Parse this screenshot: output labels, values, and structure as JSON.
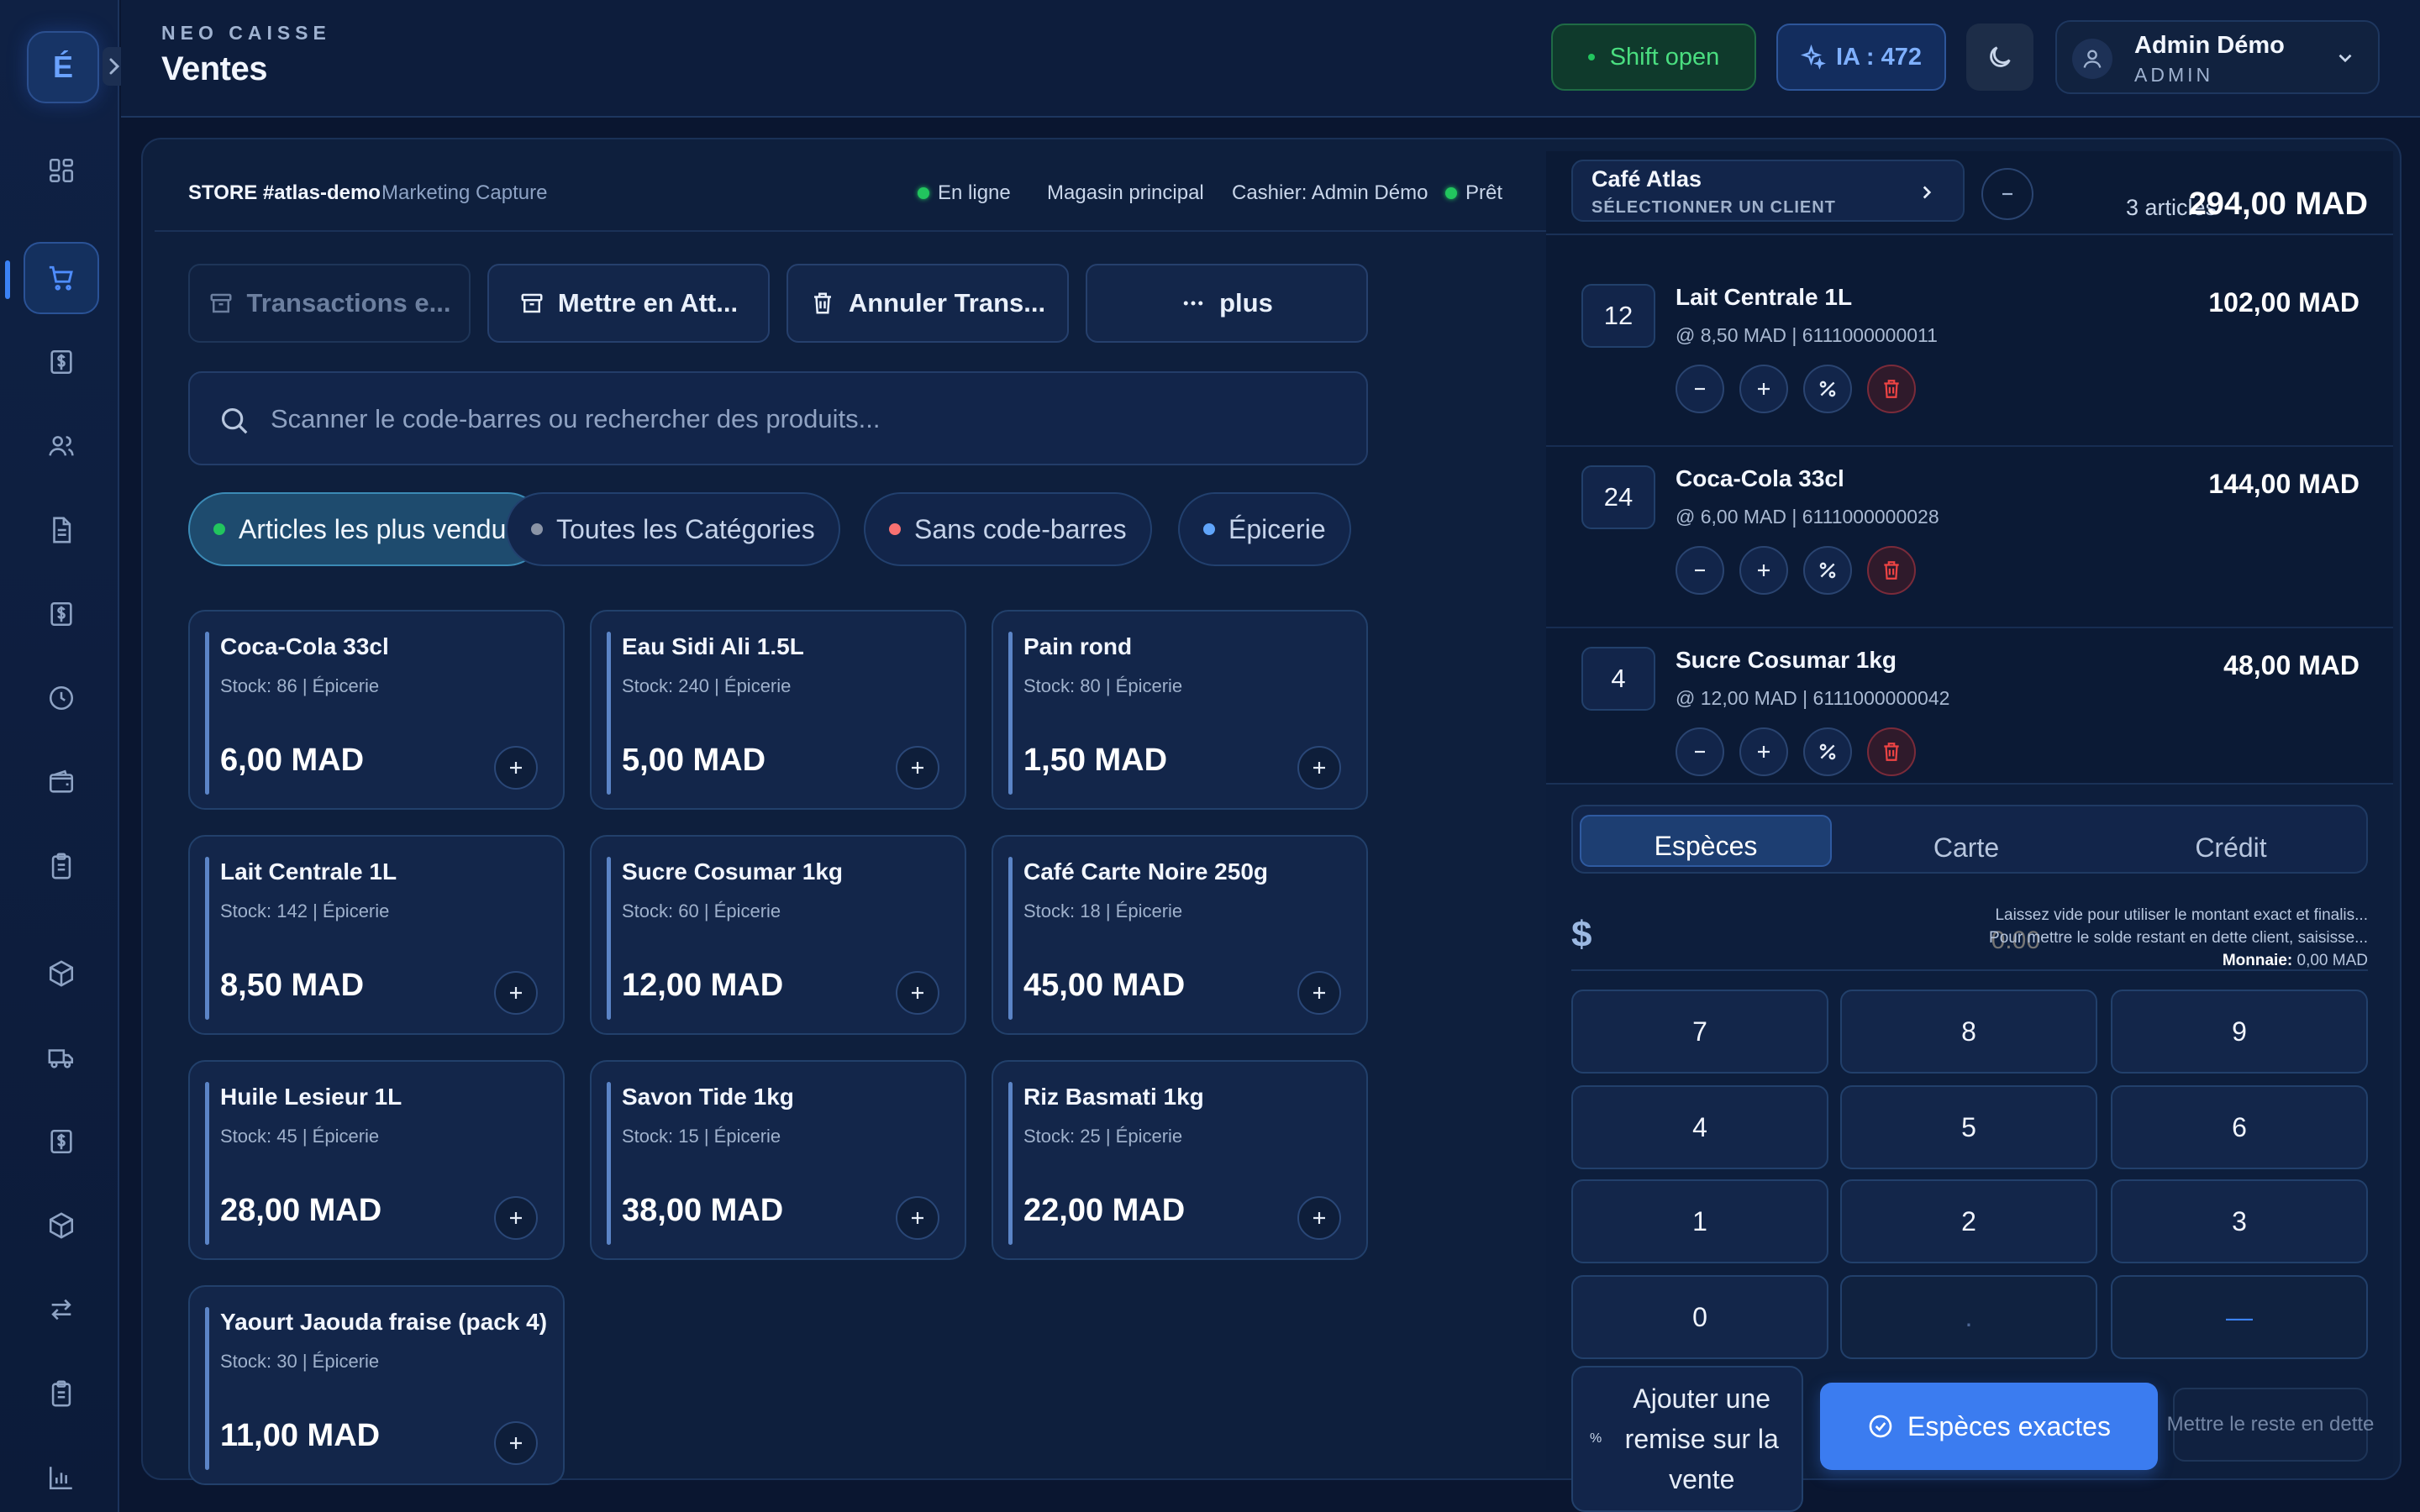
{
  "header": {
    "brand": "NEO CAISSE",
    "title": "Ventes",
    "shift_label": "Shift open",
    "ia_label": "IA : 472",
    "user_name": "Admin Démo",
    "user_role": "ADMIN"
  },
  "sidebar": {
    "logo": "É",
    "items": [
      {
        "icon": "dashboard-icon",
        "active": false
      },
      {
        "icon": "cart-icon",
        "active": true
      },
      {
        "icon": "dollar-icon",
        "active": false
      },
      {
        "icon": "users-icon",
        "active": false
      },
      {
        "icon": "document-icon",
        "active": false
      },
      {
        "icon": "dollar-icon",
        "active": false
      },
      {
        "icon": "clock-icon",
        "active": false
      },
      {
        "icon": "wallet-icon",
        "active": false
      },
      {
        "icon": "clipboard-icon",
        "active": false
      },
      {
        "icon": "box-icon",
        "active": false
      },
      {
        "icon": "truck-icon",
        "active": false
      },
      {
        "icon": "dollar-icon",
        "active": false
      },
      {
        "icon": "box-icon",
        "active": false
      },
      {
        "icon": "transfer-icon",
        "active": false
      },
      {
        "icon": "clipboard-icon",
        "active": false
      },
      {
        "icon": "chart-icon",
        "active": false
      }
    ]
  },
  "status_bar": {
    "store": "STORE #atlas-demo",
    "store_sub": "Marketing Capture",
    "online": "En ligne",
    "location": "Magasin principal",
    "cashier": "Cashier: Admin Démo",
    "ready": "Prêt"
  },
  "actions": {
    "transactions": "Transactions e...",
    "hold": "Mettre en Att...",
    "cancel": "Annuler Trans...",
    "more": "plus"
  },
  "search": {
    "placeholder": "Scanner le code-barres ou rechercher des produits..."
  },
  "categories": [
    {
      "label": "Articles les plus vendus",
      "color": "#22c55e",
      "active": true
    },
    {
      "label": "Toutes les Catégories",
      "color": "#8a94a6",
      "active": false
    },
    {
      "label": "Sans code-barres",
      "color": "#f87171",
      "active": false
    },
    {
      "label": "Épicerie",
      "color": "#60a5fa",
      "active": false
    }
  ],
  "products": [
    {
      "name": "Coca-Cola 33cl",
      "stock": "Stock: 86 | Épicerie",
      "price": "6,00 MAD"
    },
    {
      "name": "Eau Sidi Ali 1.5L",
      "stock": "Stock: 240 | Épicerie",
      "price": "5,00 MAD"
    },
    {
      "name": "Pain rond",
      "stock": "Stock: 80 | Épicerie",
      "price": "1,50 MAD"
    },
    {
      "name": "Lait Centrale 1L",
      "stock": "Stock: 142 | Épicerie",
      "price": "8,50 MAD"
    },
    {
      "name": "Sucre Cosumar 1kg",
      "stock": "Stock: 60 | Épicerie",
      "price": "12,00 MAD"
    },
    {
      "name": "Café Carte Noire 250g",
      "stock": "Stock: 18 | Épicerie",
      "price": "45,00 MAD"
    },
    {
      "name": "Huile Lesieur 1L",
      "stock": "Stock: 45 | Épicerie",
      "price": "28,00 MAD"
    },
    {
      "name": "Savon Tide 1kg",
      "stock": "Stock: 15 | Épicerie",
      "price": "38,00 MAD"
    },
    {
      "name": "Riz Basmati 1kg",
      "stock": "Stock: 25 | Épicerie",
      "price": "22,00 MAD"
    },
    {
      "name": "Yaourt Jaouda fraise (pack 4)",
      "stock": "Stock: 30 | Épicerie",
      "price": "11,00 MAD"
    }
  ],
  "cart": {
    "customer_name": "Café Atlas",
    "customer_sub": "SÉLECTIONNER UN CLIENT",
    "count": "3 articles",
    "total": "294,00 MAD",
    "items": [
      {
        "qty": "12",
        "name": "Lait Centrale 1L",
        "meta": "@ 8,50 MAD | 6111000000011",
        "total": "102,00 MAD"
      },
      {
        "qty": "24",
        "name": "Coca-Cola 33cl",
        "meta": "@ 6,00 MAD | 6111000000028",
        "total": "144,00 MAD"
      },
      {
        "qty": "4",
        "name": "Sucre Cosumar 1kg",
        "meta": "@ 12,00 MAD | 6111000000042",
        "total": "48,00 MAD"
      }
    ]
  },
  "payment": {
    "tabs": [
      "Espèces",
      "Carte",
      "Crédit"
    ],
    "currency": "$",
    "amount_placeholder": "0.00",
    "hint1": "Laissez vide pour utiliser le montant exact et finalis...",
    "hint2": "Pour mettre le solde restant en dette client, saisisse...",
    "change_label": "Monnaie:",
    "change_value": "0,00 MAD",
    "keys": [
      "7",
      "8",
      "9",
      "4",
      "5",
      "6",
      "1",
      "2",
      "3",
      "0",
      ".",
      "—"
    ],
    "discount": "Ajouter une remise sur la vente",
    "exact": "Espèces exactes",
    "debt": "Mettre le reste en dette"
  }
}
